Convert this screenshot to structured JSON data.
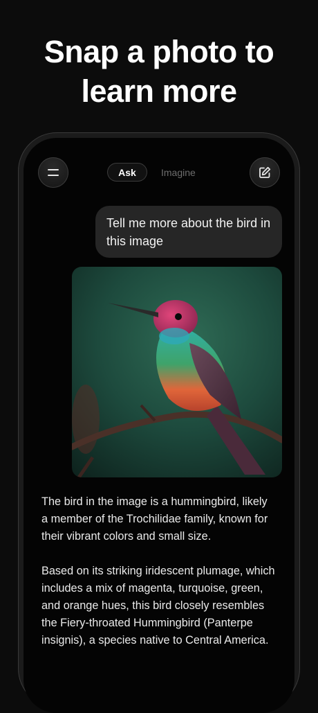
{
  "headline": {
    "line1": "Snap a photo to",
    "line2": "learn more"
  },
  "header": {
    "tab_ask": "Ask",
    "tab_imagine": "Imagine"
  },
  "chat": {
    "user_message": "Tell me more about the bird in this image",
    "answer_p1": "The bird in the image is a hummingbird, likely a member of the Trochilidae family, known for their vibrant colors and small size.",
    "answer_p2": "Based on its striking iridescent plumage, which includes a mix of magenta, turquoise, green, and orange hues, this bird closely resembles the Fiery-throated Hummingbird (Panterpe insignis), a species native to Central America."
  },
  "icons": {
    "menu": "menu-icon",
    "edit": "edit-icon"
  },
  "colors": {
    "background": "#0c0c0c",
    "bubble": "#262626",
    "tab_inactive": "#6e6e6e"
  }
}
